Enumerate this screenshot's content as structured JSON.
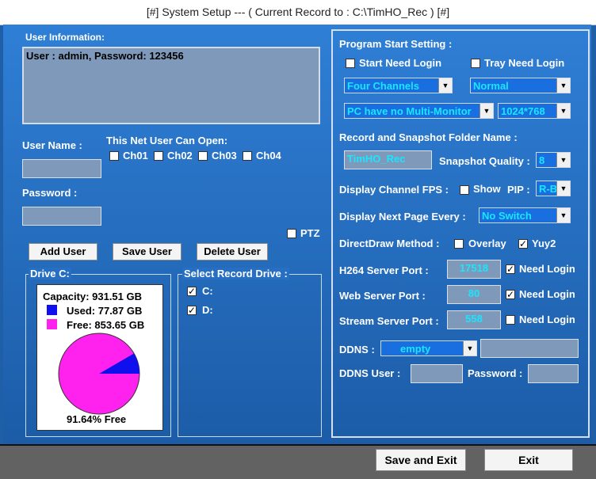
{
  "window": {
    "title": "[#] System Setup --- ( Current Record to : C:\\TimHO_Rec ) [#]"
  },
  "user_info": {
    "label": "User Information:",
    "text": "User : admin, Password: 123456",
    "username_label": "User Name :",
    "password_label": "Password :",
    "username_value": "",
    "password_value": "",
    "net_user_label": "This Net User Can Open:",
    "channels": [
      {
        "label": "Ch01",
        "checked": false
      },
      {
        "label": "Ch02",
        "checked": false
      },
      {
        "label": "Ch03",
        "checked": false
      },
      {
        "label": "Ch04",
        "checked": false
      }
    ],
    "ptz_label": "PTZ",
    "ptz_checked": false,
    "add_button": "Add User",
    "save_button": "Save User",
    "delete_button": "Delete User"
  },
  "drive": {
    "title": "Drive C:",
    "capacity": "Capacity: 931.51 GB",
    "used": "Used: 77.87 GB",
    "free": "Free: 853.65 GB",
    "free_percent_text": "91.64% Free",
    "free_fraction": 0.9164,
    "used_color": "#1010ee",
    "free_color": "#ff22ee"
  },
  "record_drive": {
    "title": "Select Record Drive :",
    "drives": [
      {
        "label": "C:",
        "checked": true
      },
      {
        "label": "D:",
        "checked": true
      }
    ]
  },
  "program": {
    "title": "Program Start Setting :",
    "start_need_login": "Start Need Login",
    "start_need_login_checked": false,
    "tray_need_login": "Tray Need Login",
    "tray_need_login_checked": false,
    "channels_select": "Four Channels",
    "mode_select": "Normal",
    "monitor_select": "PC have no Multi-Monitor",
    "resolution_select": "1024*768",
    "folder_label": "Record and Snapshot Folder Name :",
    "folder_value": "TimHO_Rec",
    "snapshot_label": "Snapshot Quality :",
    "snapshot_value": "8",
    "fps_label": "Display Channel FPS :",
    "fps_show_label": "Show",
    "fps_show_checked": false,
    "pip_label": "PIP :",
    "pip_value": "R-B",
    "next_page_label": "Display Next Page Every :",
    "next_page_value": "No Switch",
    "directdraw_label": "DirectDraw Method :",
    "overlay_label": "Overlay",
    "overlay_checked": false,
    "yuy2_label": "Yuy2",
    "yuy2_checked": true,
    "h264_label": "H264 Server Port :",
    "h264_value": "17518",
    "h264_login_label": "Need Login",
    "h264_login_checked": true,
    "web_label": "Web Server Port :",
    "web_value": "80",
    "web_login_label": "Need Login",
    "web_login_checked": true,
    "stream_label": "Stream Server Port :",
    "stream_value": "558",
    "stream_login_label": "Need Login",
    "stream_login_checked": false,
    "ddns_label": "DDNS :",
    "ddns_value": "empty",
    "ddns_host_value": "",
    "ddns_user_label": "DDNS User :",
    "ddns_user_value": "",
    "ddns_password_label": "Password :",
    "ddns_password_value": ""
  },
  "footer": {
    "save_exit": "Save and Exit",
    "exit": "Exit"
  }
}
